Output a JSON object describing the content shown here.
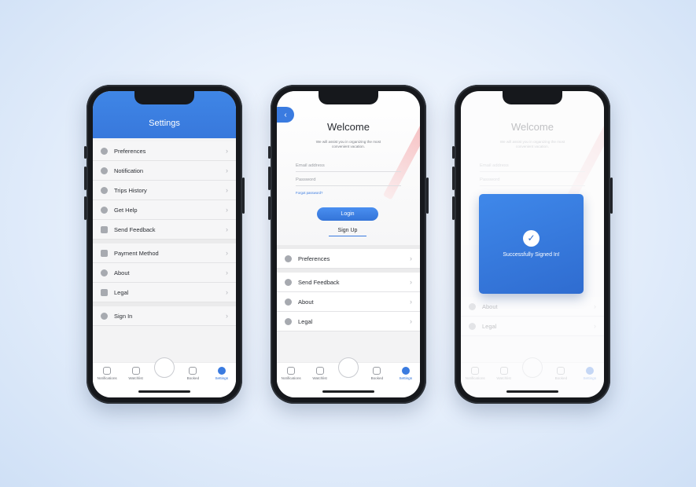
{
  "settings_screen": {
    "title": "Settings",
    "group1": [
      {
        "label": "Preferences",
        "icon": "gear-icon"
      },
      {
        "label": "Notification",
        "icon": "drop-icon"
      },
      {
        "label": "Trips History",
        "icon": "history-icon"
      },
      {
        "label": "Get Help",
        "icon": "help-icon"
      },
      {
        "label": "Send Feedback",
        "icon": "feedback-icon"
      }
    ],
    "group2": [
      {
        "label": "Payment Method",
        "icon": "card-icon"
      },
      {
        "label": "About",
        "icon": "info-icon"
      },
      {
        "label": "Legal",
        "icon": "gavel-icon"
      }
    ],
    "group3": [
      {
        "label": "Sign In",
        "icon": "sign-in-icon"
      }
    ]
  },
  "login_screen": {
    "title": "Welcome",
    "subtitle": "We will assist you in organizing the most convenient vacation.",
    "email_placeholder": "Email address",
    "password_placeholder": "Password",
    "forgot_label": "Forgot password?",
    "login_label": "Login",
    "signup_label": "Sign Up",
    "rows": [
      {
        "label": "Preferences",
        "icon": "gear-icon"
      },
      {
        "label": "Send Feedback",
        "icon": "feedback-icon"
      },
      {
        "label": "About",
        "icon": "info-icon"
      },
      {
        "label": "Legal",
        "icon": "gavel-icon"
      }
    ]
  },
  "success_screen": {
    "background_title": "Welcome",
    "background_subtitle": "We will assist you in organizing the most convenient vacation.",
    "background_email": "Email address",
    "background_password": "Password",
    "background_rows": [
      "About",
      "Legal"
    ],
    "message": "Successfully Signed In!"
  },
  "tabbar": [
    {
      "label": "Notifications",
      "icon": "bell-icon"
    },
    {
      "label": "Watchlist",
      "icon": "bookmark-icon"
    },
    {
      "label": "",
      "icon": "search-globe-icon"
    },
    {
      "label": "Booked",
      "icon": "person-icon"
    },
    {
      "label": "Settings",
      "icon": "gear-icon"
    }
  ],
  "colors": {
    "accent": "#3a7be0",
    "header": "#3f86e6",
    "background": "#e9f1fc"
  }
}
